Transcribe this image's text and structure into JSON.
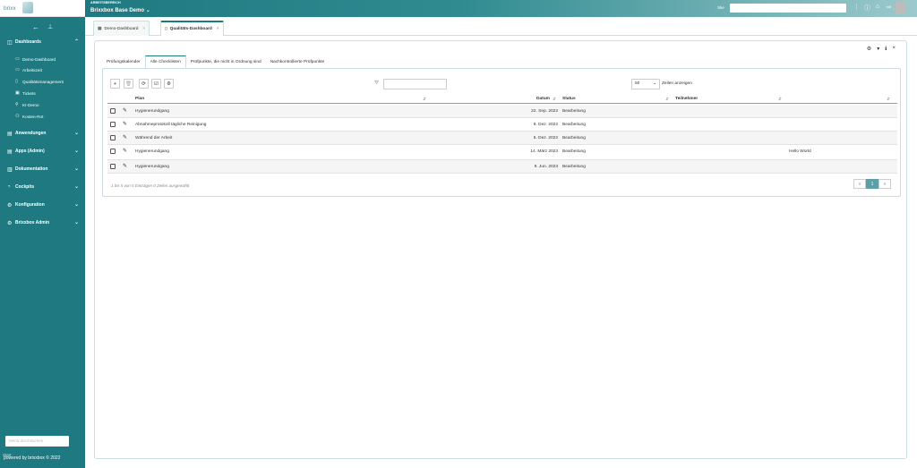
{
  "brand": {
    "logo_text": "brixx"
  },
  "sidebar": {
    "sections": [
      {
        "label": "Dashboards",
        "icon": "dashboard-icon"
      },
      {
        "label": "Anwendungen",
        "icon": "apps-icon"
      },
      {
        "label": "Apps (Admin)",
        "icon": "admin-apps-icon"
      },
      {
        "label": "Dokumentation",
        "icon": "docs-icon"
      },
      {
        "label": "Cockpits",
        "icon": "cockpit-icon"
      },
      {
        "label": "Konfiguration",
        "icon": "config-icon"
      },
      {
        "label": "Brixxbox Admin",
        "icon": "admin-icon"
      }
    ],
    "dashboards": [
      {
        "label": "Demo-Dashboard"
      },
      {
        "label": "Arbeitszeit"
      },
      {
        "label": "Qualitätsmanagement"
      },
      {
        "label": "Tickets"
      },
      {
        "label": "KI-Demo"
      },
      {
        "label": "Kosten-Rot"
      }
    ],
    "search_placeholder": "Menü durchsuchen",
    "powered_by": "powered by brixxbox © 2022",
    "start_label": "Start"
  },
  "topbar": {
    "workspace_label": "ARBEITSBEREICH",
    "workspace_name": "Brixxbox Base Demo",
    "search_label": "Ske",
    "icons": [
      "menu-dots-icon",
      "info-icon",
      "home-icon",
      "share-icon"
    ]
  },
  "doc_tabs": [
    {
      "label": "Demo-Dashboard",
      "active": false
    },
    {
      "label": "Qualitäts-Dashboard",
      "active": true
    }
  ],
  "inner_tabs": [
    {
      "label": "Prüfungskalender",
      "active": false
    },
    {
      "label": "Alle Checklisten",
      "active": true
    },
    {
      "label": "Prüfpunkte, die nicht in Ordnung sind",
      "active": false
    },
    {
      "label": "Nachkontrollierte Prüfpunkte",
      "active": false
    }
  ],
  "toolbar": {
    "rows_value": "50",
    "rows_label": "Zeilen anzeigen"
  },
  "table": {
    "columns": [
      "Plan",
      "Datum",
      "Status",
      "Teilnehmer"
    ],
    "rows": [
      {
        "plan": "Hygienerundgang",
        "datum": "22. Sep. 2022",
        "status": "Bearbeitung",
        "extra": ""
      },
      {
        "plan": "Abnahmeprotokoll tägliche Reinigung",
        "datum": "9. Dez. 2022",
        "status": "Bearbeitung",
        "extra": ""
      },
      {
        "plan": "Während der Arbeit",
        "datum": "5. Dez. 2022",
        "status": "Bearbeitung",
        "extra": ""
      },
      {
        "plan": "Hygienerundgang",
        "datum": "14. März 2023",
        "status": "Bearbeitung",
        "extra": "Hello World"
      },
      {
        "plan": "Hygienerundgang",
        "datum": "9. Jun. 2023",
        "status": "Bearbeitung",
        "extra": ""
      }
    ],
    "info": "1 bis 5 von 5 Einträgen    0 Zeilen ausgewählt"
  },
  "pager": {
    "prev": "«",
    "current": "1",
    "next": "»"
  }
}
